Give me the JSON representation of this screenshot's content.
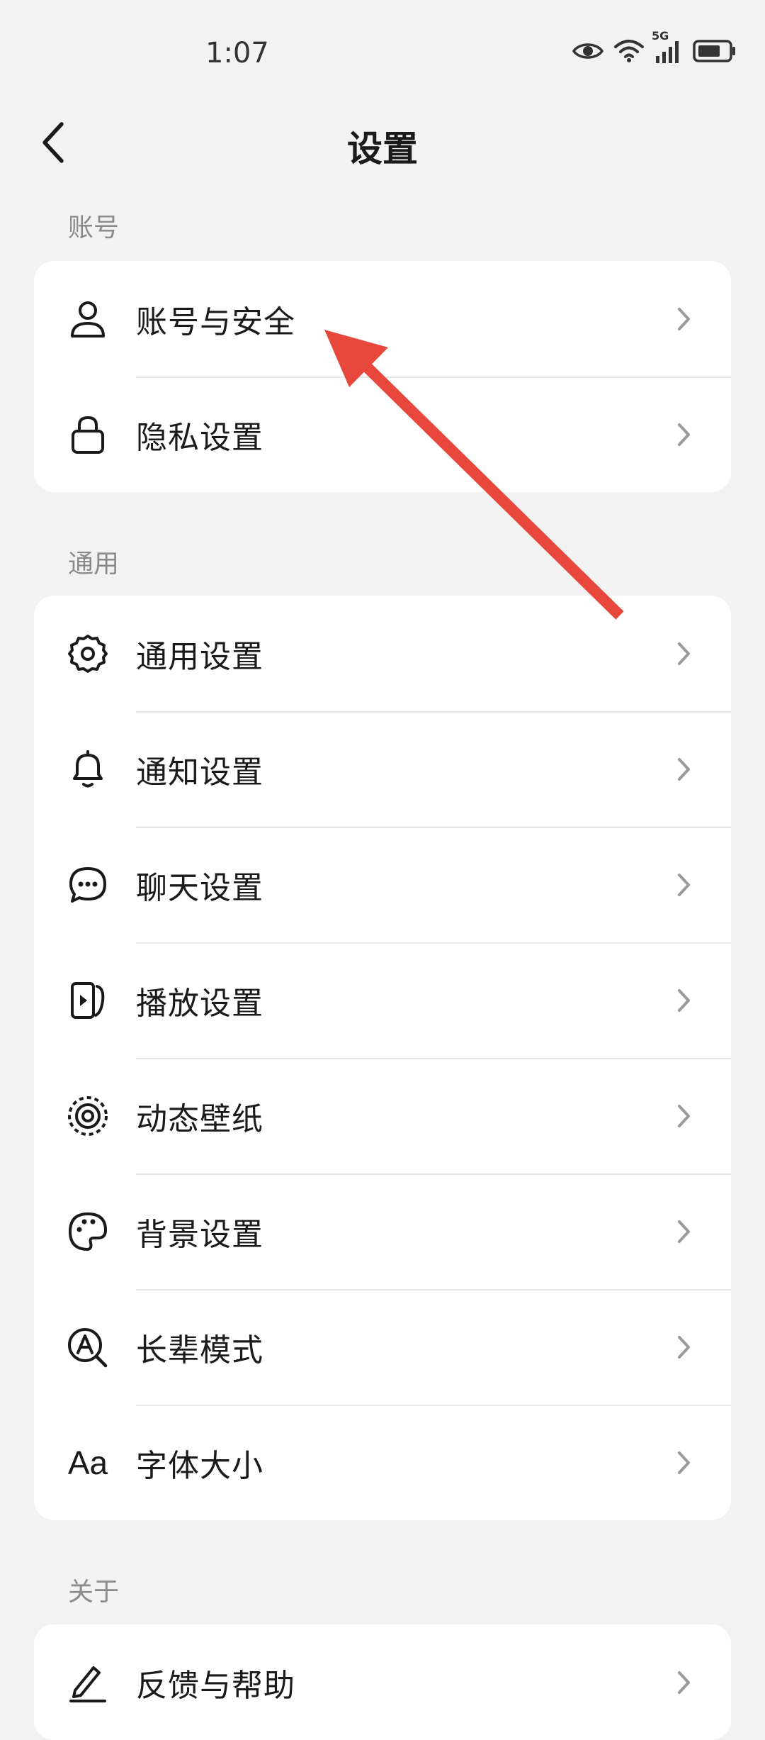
{
  "status_bar": {
    "time": "1:07",
    "network_label": "5G",
    "icons": [
      "eye-icon",
      "wifi-icon",
      "signal-5g-icon",
      "battery-icon"
    ]
  },
  "header": {
    "title": "设置",
    "back_icon": "chevron-left-icon"
  },
  "sections": [
    {
      "title": "账号",
      "items": [
        {
          "label": "账号与安全",
          "icon": "user-icon"
        },
        {
          "label": "隐私设置",
          "icon": "lock-icon"
        }
      ]
    },
    {
      "title": "通用",
      "items": [
        {
          "label": "通用设置",
          "icon": "gear-icon"
        },
        {
          "label": "通知设置",
          "icon": "bell-icon"
        },
        {
          "label": "聊天设置",
          "icon": "chat-bubble-icon"
        },
        {
          "label": "播放设置",
          "icon": "play-icon"
        },
        {
          "label": "动态壁纸",
          "icon": "live-wallpaper-icon"
        },
        {
          "label": "背景设置",
          "icon": "palette-icon"
        },
        {
          "label": "长辈模式",
          "icon": "elder-mode-icon"
        },
        {
          "label": "字体大小",
          "icon": "font-size-icon",
          "icon_text": "Aa"
        }
      ]
    },
    {
      "title": "关于",
      "items": [
        {
          "label": "反馈与帮助",
          "icon": "edit-pen-icon"
        }
      ]
    }
  ],
  "colors": {
    "background": "#f2f2f2",
    "card": "#ffffff",
    "section_header": "#8a8a8a",
    "chevron": "#9a9a9a",
    "annotation_arrow": "#e8473b"
  }
}
